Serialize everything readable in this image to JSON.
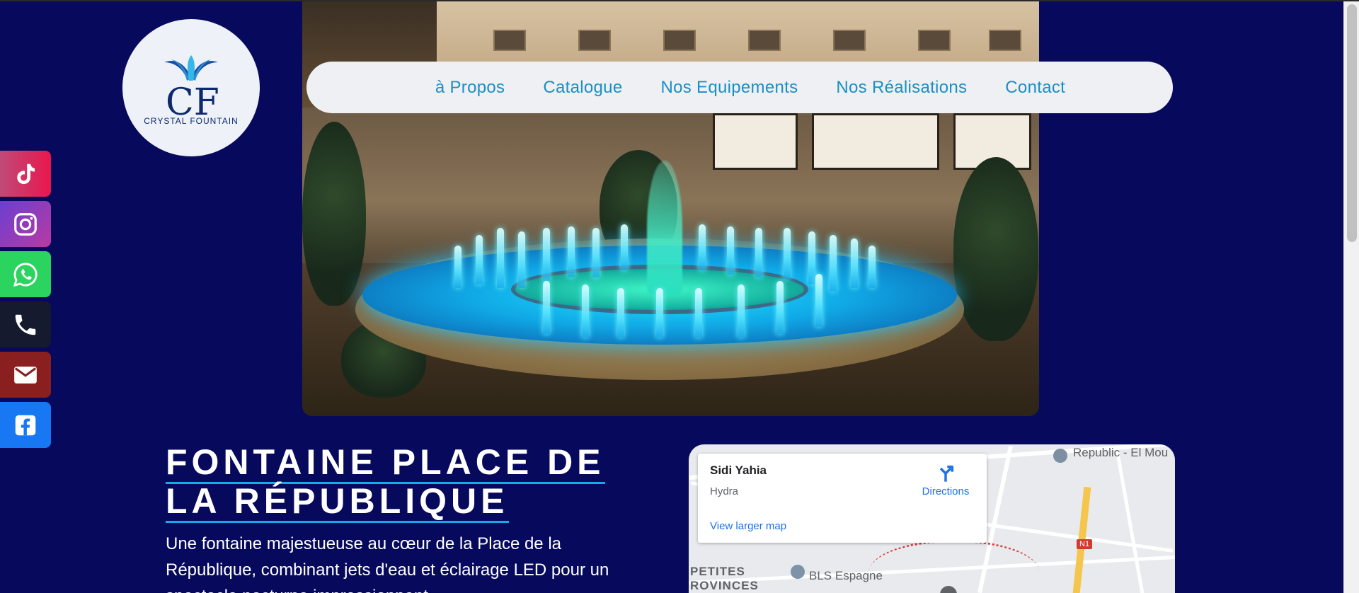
{
  "logo": {
    "monogram": "CF",
    "text": "CRYSTAL FOUNTAIN"
  },
  "nav": {
    "items": [
      {
        "label": "à Propos"
      },
      {
        "label": "Catalogue"
      },
      {
        "label": "Nos Equipements"
      },
      {
        "label": "Nos Réalisations"
      },
      {
        "label": "Contact"
      }
    ]
  },
  "social": {
    "items": [
      {
        "icon": "tiktok-icon",
        "color": "#e8174d"
      },
      {
        "icon": "instagram-icon",
        "color": "#8c3bd0"
      },
      {
        "icon": "whatsapp-icon",
        "color": "#2bd45e"
      },
      {
        "icon": "phone-icon",
        "color": "#151a2e"
      },
      {
        "icon": "mail-icon",
        "color": "#8a1f1f"
      },
      {
        "icon": "facebook-icon",
        "color": "#1877f2"
      }
    ]
  },
  "project": {
    "title_line1": "FONTAINE PLACE DE",
    "title_line2": "LA RÉPUBLIQUE",
    "description": "Une fontaine majestueuse au cœur de la Place de la République, combinant jets d'eau et éclairage LED pour un spectacle nocturne impressionnant."
  },
  "map": {
    "place_name": "Sidi Yahia",
    "place_sub": "Hydra",
    "directions_label": "Directions",
    "larger_map_label": "View larger map",
    "labels": {
      "republic": "Republic - El Mou",
      "petites": "PETITES",
      "rovinces": "ROVINCES",
      "bls": "BLS Espagne",
      "n1": "N1"
    }
  },
  "colors": {
    "background": "#070a5c",
    "nav_bg": "#eef0f3",
    "nav_link": "#1a8fc4",
    "title_underline": "#1aa8e8"
  }
}
